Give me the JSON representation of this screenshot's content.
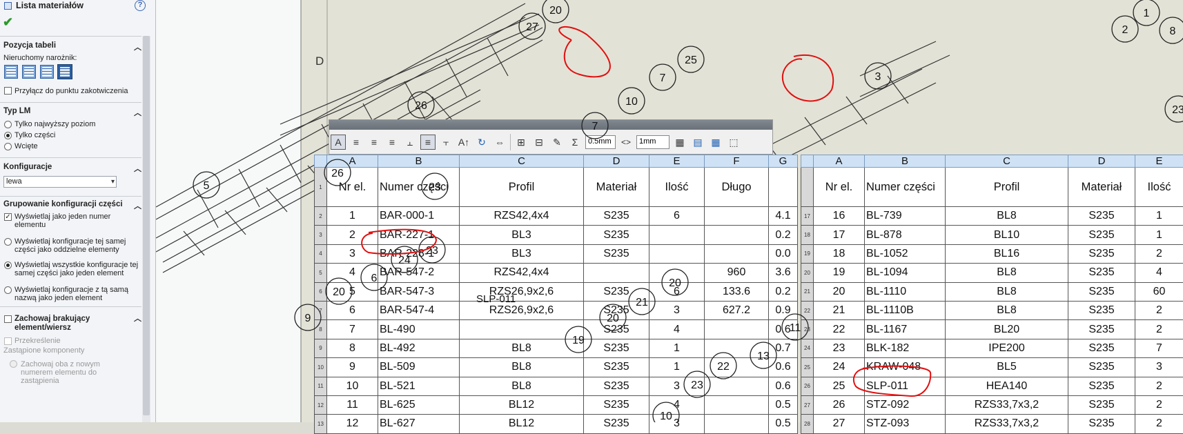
{
  "property_manager": {
    "title": "Lista materiałów",
    "help": "?",
    "ok_symbol": "✔",
    "table_position": {
      "heading": "Pozycja tabeli",
      "anchor_label": "Nieruchomy narożnik:",
      "attach_label": "Przyłącz do punktu zakotwiczenia"
    },
    "bom_type": {
      "heading": "Typ LM",
      "options": [
        "Tylko najwyższy poziom",
        "Tylko części",
        "Wcięte"
      ]
    },
    "configurations": {
      "heading": "Konfiguracje",
      "value": "lewa"
    },
    "grouping": {
      "heading": "Grupowanie konfiguracji części",
      "options": [
        "Wyświetlaj jako jeden numer elementu",
        "Wyświetlaj konfiguracje tej samej części jako oddzielne elementy",
        "Wyświetlaj wszystkie konfiguracje tej samej części jako jeden element",
        "Wyświetlaj konfiguracje z tą samą nazwą jako jeden element"
      ]
    },
    "missing": {
      "heading": "Zachowaj brakujący element/wiersz",
      "strikeout": "Przekreślenie",
      "replaced": "Zastąpione komponenty",
      "keep_both": "Zachowaj oba z nowym numerem elementu do zastąpienia"
    }
  },
  "toolbar": {
    "line_width": "0.5mm",
    "arrows": "<>",
    "height": "1mm"
  },
  "drawing": {
    "sheet_zone_letter": "D"
  },
  "bom_left": {
    "col_letters": [
      "A",
      "B",
      "C",
      "D",
      "E",
      "F",
      "G"
    ],
    "headers": [
      "Nr el.",
      "Numer części",
      "Profil",
      "Materiał",
      "Ilość",
      "Długo",
      ""
    ],
    "rows": [
      {
        "rn": "2",
        "c": [
          "1",
          "BAR-000-1",
          "RZS42,4x4",
          "S235",
          "6",
          "",
          "4.1"
        ]
      },
      {
        "rn": "3",
        "c": [
          "2",
          "BAR-227-1",
          "BL3",
          "S235",
          "",
          "",
          "0.2"
        ]
      },
      {
        "rn": "4",
        "c": [
          "3",
          "BAR-228-1",
          "BL3",
          "S235",
          "",
          "",
          "0.0"
        ]
      },
      {
        "rn": "5",
        "c": [
          "4",
          "BAR-547-2",
          "RZS42,4x4",
          "",
          "",
          "960",
          "3.6"
        ]
      },
      {
        "rn": "6",
        "c": [
          "5",
          "BAR-547-3",
          "RZS26,9x2,6",
          "S235",
          "6",
          "133.6",
          "0.2"
        ]
      },
      {
        "rn": "7",
        "c": [
          "6",
          "BAR-547-4",
          "RZS26,9x2,6",
          "S235",
          "3",
          "627.2",
          "0.9"
        ]
      },
      {
        "rn": "8",
        "c": [
          "7",
          "BL-490",
          "",
          "S235",
          "4",
          "",
          "0.6"
        ]
      },
      {
        "rn": "9",
        "c": [
          "8",
          "BL-492",
          "BL8",
          "S235",
          "1",
          "",
          "0.7"
        ]
      },
      {
        "rn": "10",
        "c": [
          "9",
          "BL-509",
          "BL8",
          "S235",
          "1",
          "",
          "0.6"
        ]
      },
      {
        "rn": "11",
        "c": [
          "10",
          "BL-521",
          "BL8",
          "S235",
          "3",
          "",
          "0.6"
        ]
      },
      {
        "rn": "12",
        "c": [
          "11",
          "BL-625",
          "BL12",
          "S235",
          "4",
          "",
          "0.5"
        ]
      },
      {
        "rn": "13",
        "c": [
          "12",
          "BL-627",
          "BL12",
          "S235",
          "3",
          "",
          "0.5"
        ]
      }
    ]
  },
  "bom_right": {
    "col_letters": [
      "A",
      "B",
      "C",
      "D",
      "E"
    ],
    "headers": [
      "Nr el.",
      "Numer części",
      "Profil",
      "Materiał",
      "Ilość"
    ],
    "rows": [
      {
        "rn": "17",
        "c": [
          "16",
          "BL-739",
          "BL8",
          "S235",
          "1"
        ]
      },
      {
        "rn": "18",
        "c": [
          "17",
          "BL-878",
          "BL10",
          "S235",
          "1"
        ]
      },
      {
        "rn": "19",
        "c": [
          "18",
          "BL-1052",
          "BL16",
          "S235",
          "2"
        ]
      },
      {
        "rn": "20",
        "c": [
          "19",
          "BL-1094",
          "BL8",
          "S235",
          "4"
        ]
      },
      {
        "rn": "21",
        "c": [
          "20",
          "BL-1110",
          "BL8",
          "S235",
          "60"
        ]
      },
      {
        "rn": "22",
        "c": [
          "21",
          "BL-1110B",
          "BL8",
          "S235",
          "2"
        ]
      },
      {
        "rn": "23",
        "c": [
          "22",
          "BL-1167",
          "BL20",
          "S235",
          "2"
        ]
      },
      {
        "rn": "24",
        "c": [
          "23",
          "BLK-182",
          "IPE200",
          "S235",
          "7"
        ]
      },
      {
        "rn": "25",
        "c": [
          "24",
          "KRAW-048",
          "BL5",
          "S235",
          "3"
        ]
      },
      {
        "rn": "26",
        "c": [
          "25",
          "SLP-011",
          "HEA140",
          "S235",
          "2"
        ]
      },
      {
        "rn": "27",
        "c": [
          "26",
          "STZ-092",
          "RZS33,7x3,2",
          "S235",
          "2"
        ]
      },
      {
        "rn": "28",
        "c": [
          "27",
          "STZ-093",
          "RZS33,7x3,2",
          "S235",
          "2"
        ]
      }
    ]
  },
  "balloons": [
    "20",
    "27",
    "25",
    "7",
    "10",
    "7",
    "26",
    "5",
    "26",
    "23",
    "24",
    "6",
    "20",
    "9",
    "23",
    "2",
    "1",
    "8",
    "3",
    "23",
    "20",
    "21",
    "20",
    "19",
    "22",
    "13",
    "11",
    "23",
    "10",
    "SLP-011"
  ]
}
